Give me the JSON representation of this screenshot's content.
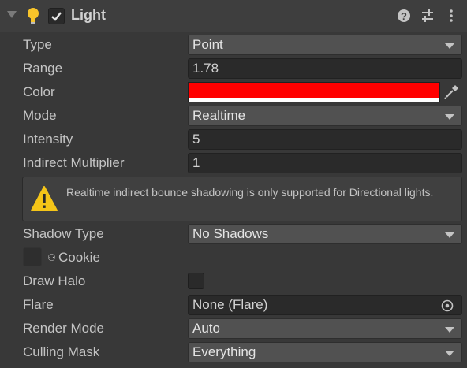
{
  "component": {
    "title": "Light",
    "enabled": true,
    "icons": [
      "foldout-arrow-icon",
      "light-bulb-icon",
      "help-icon",
      "preset-icon",
      "more-options-icon"
    ]
  },
  "fields": {
    "type": {
      "label": "Type",
      "value": "Point"
    },
    "range": {
      "label": "Range",
      "value": "1.78"
    },
    "color": {
      "label": "Color",
      "value": "#ff0000",
      "alpha": 1
    },
    "mode": {
      "label": "Mode",
      "value": "Realtime"
    },
    "intensity": {
      "label": "Intensity",
      "value": "5"
    },
    "indirect_multiplier": {
      "label": "Indirect Multiplier",
      "value": "1"
    },
    "shadow_type": {
      "label": "Shadow Type",
      "value": "No Shadows"
    },
    "cookie": {
      "label": "Cookie",
      "icon": "cookie-icon"
    },
    "draw_halo": {
      "label": "Draw Halo",
      "checked": false
    },
    "flare": {
      "label": "Flare",
      "value": "None (Flare)"
    },
    "render_mode": {
      "label": "Render Mode",
      "value": "Auto"
    },
    "culling_mask": {
      "label": "Culling Mask",
      "value": "Everything"
    }
  },
  "warning": {
    "text": "Realtime indirect bounce shadowing is only supported for Directional lights.",
    "icon": "warning-icon"
  },
  "colors": {
    "panel_bg": "#383838",
    "field_bg": "#2a2a2a",
    "dropdown_bg": "#515151",
    "light_color": "#ff0000",
    "warning_yellow": "#f5c518"
  }
}
